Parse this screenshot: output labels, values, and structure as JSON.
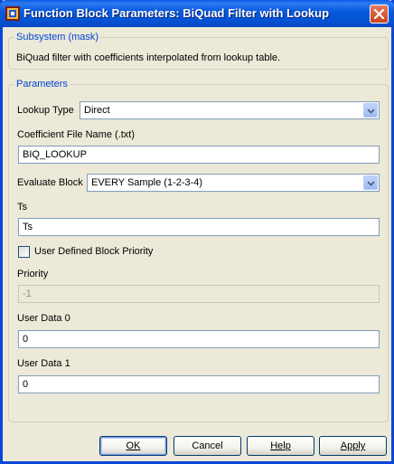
{
  "window": {
    "title": "Function Block Parameters: BiQuad Filter with Lookup",
    "icon": "simulink-block-icon"
  },
  "subsystem": {
    "legend": "Subsystem (mask)",
    "description": "BiQuad filter with coefficients interpolated from lookup table."
  },
  "parameters": {
    "legend": "Parameters",
    "lookup_type_label": "Lookup Type",
    "lookup_type_value": "Direct",
    "coef_file_label": "Coefficient File Name (.txt)",
    "coef_file_value": "BIQ_LOOKUP",
    "evaluate_block_label": "Evaluate Block",
    "evaluate_block_value": "EVERY Sample (1-2-3-4)",
    "ts_label": "Ts",
    "ts_value": "Ts",
    "user_priority_label": "User Defined Block Priority",
    "user_priority_checked": false,
    "priority_label": "Priority",
    "priority_value": "-1",
    "user_data0_label": "User Data 0",
    "user_data0_value": "0",
    "user_data1_label": "User Data 1",
    "user_data1_value": "0"
  },
  "buttons": {
    "ok": "OK",
    "cancel": "Cancel",
    "help": "Help",
    "apply": "Apply"
  },
  "colors": {
    "titlebar": "#0a5ade",
    "legend": "#0046d5",
    "dialog_bg": "#ece9d8"
  }
}
